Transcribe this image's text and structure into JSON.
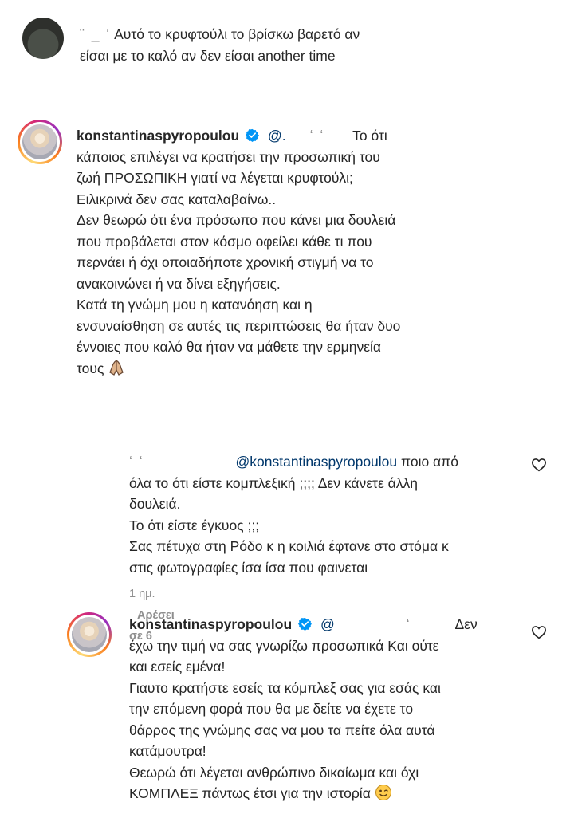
{
  "comments": [
    {
      "masked_name": "¨   _   ʻ",
      "lines": [
        "Αυτό το κρυφτούλι το βρίσκω βαρετό αν",
        "είσαι με το καλό αν δεν είσαι another time"
      ]
    },
    {
      "username": "konstantinaspyropoulou",
      "mention": "@.",
      "masked": "ʻ    ʻ",
      "lines": [
        "Το ότι",
        "κάποιος επιλέγει να κρατήσει την προσωπική του",
        "ζωή ΠΡΟΣΩΠΙΚΗ γιατί να λέγεται κρυφτούλι;",
        "Ειλικρινά δεν σας καταλαβαίνω..",
        "Δεν θεωρώ ότι ένα πρόσωπο που κάνει μια δουλειά",
        "που προβάλεται στον κόσμο οφείλει κάθε τι που",
        "περνάει ή όχι οποιαδήποτε χρονική στιγμή να το",
        "ανακοινώνει ή να δίνει εξηγήσεις.",
        "Κατά τη γνώμη μου η κατανόηση και η",
        "ενσυναίσθηση σε αυτές τις περιπτώσεις θα ήταν δυο",
        "έννοιες που καλό θα ήταν να μάθετε την ερμηνεία",
        "τους"
      ],
      "emoji": "praying-hands-emoji"
    },
    {
      "masked_name": "ʻ   ʻ",
      "mention": "@konstantinaspyropoulou",
      "lines": [
        "ποιο από",
        "όλα το ότι είστε κομπλεξική ;;;; Δεν κάνετε άλλη",
        "δουλειά.",
        "Το ότι είστε έγκυος ;;;",
        "Σας πέτυχα στη Ρόδο κ η κοιλιά έφτανε στο στόμα κ",
        "στις φωτογραφίες ίσα ίσα που φαινεται"
      ],
      "time": "1 ημ.",
      "likes": "Αρέσει σε 6"
    },
    {
      "username": "konstantinaspyropoulou",
      "mention": "@",
      "masked": "ʻ",
      "lines": [
        "Δεν",
        "έχω την τιμή να σας γνωρίζω προσωπικά Και ούτε",
        "και εσείς εμένα!",
        "Γιαυτο κρατήστε εσείς τα κόμπλεξ σας για εσάς και",
        "την επόμενη φορά που θα με δείτε να έχετε το",
        "θάρρος της γνώμης σας να μου τα πείτε όλα αυτά",
        "κατάμουτρα!",
        "Θεωρώ ότι λέγεται ανθρώπινο δικαίωμα και όχι",
        "ΚΟΜΠΛΕΞ πάντως έτσι για την ιστορία"
      ],
      "emoji": "winking-face-emoji"
    }
  ],
  "colors": {
    "text": "#262626",
    "mention": "#00376b",
    "meta": "#8e8e8e",
    "verified": "#0095f6"
  }
}
